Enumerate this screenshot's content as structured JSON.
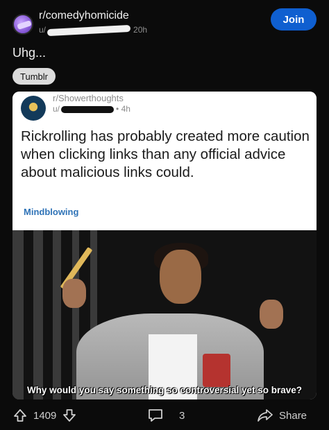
{
  "header": {
    "subreddit": "r/comedyhomicide",
    "user_prefix": "u/",
    "age": "20h",
    "join_label": "Join"
  },
  "post": {
    "title": "Uhg...",
    "flair": "Tumblr"
  },
  "embedded_post": {
    "subreddit": "r/Showerthoughts",
    "user_prefix": "u/",
    "age": "4h",
    "text": "Rickrolling has probably created more caution when clicking links than any official advice about malicious links could.",
    "flair": "Mindblowing"
  },
  "meme": {
    "caption": "Why would you say something so controversial yet so brave?"
  },
  "actions": {
    "upvotes": "1409",
    "comments": "3",
    "share_label": "Share"
  },
  "colors": {
    "background": "#0b0b0b",
    "join_button": "#0f5fd0",
    "flair_bg": "#dcdcdc",
    "inner_flair_text": "#2f73b7"
  },
  "icons": {
    "upvote": "arrow-up-icon",
    "downvote": "arrow-down-icon",
    "comment": "comment-icon",
    "share": "share-arrow-icon"
  }
}
